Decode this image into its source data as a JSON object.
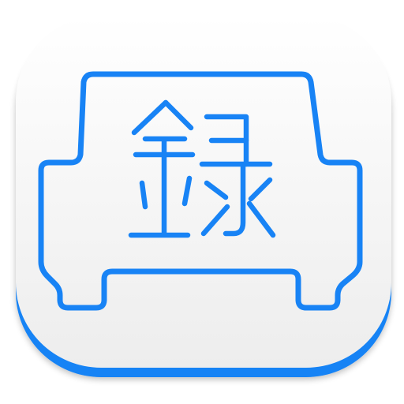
{
  "icon": {
    "name": "car-recorder-app-icon",
    "glyph": "録",
    "colors": {
      "accent": "#1883F5",
      "accent_dark": "#0F6FE0",
      "tile_top": "#FFFFFF",
      "tile_bottom": "#ECECEC"
    }
  }
}
